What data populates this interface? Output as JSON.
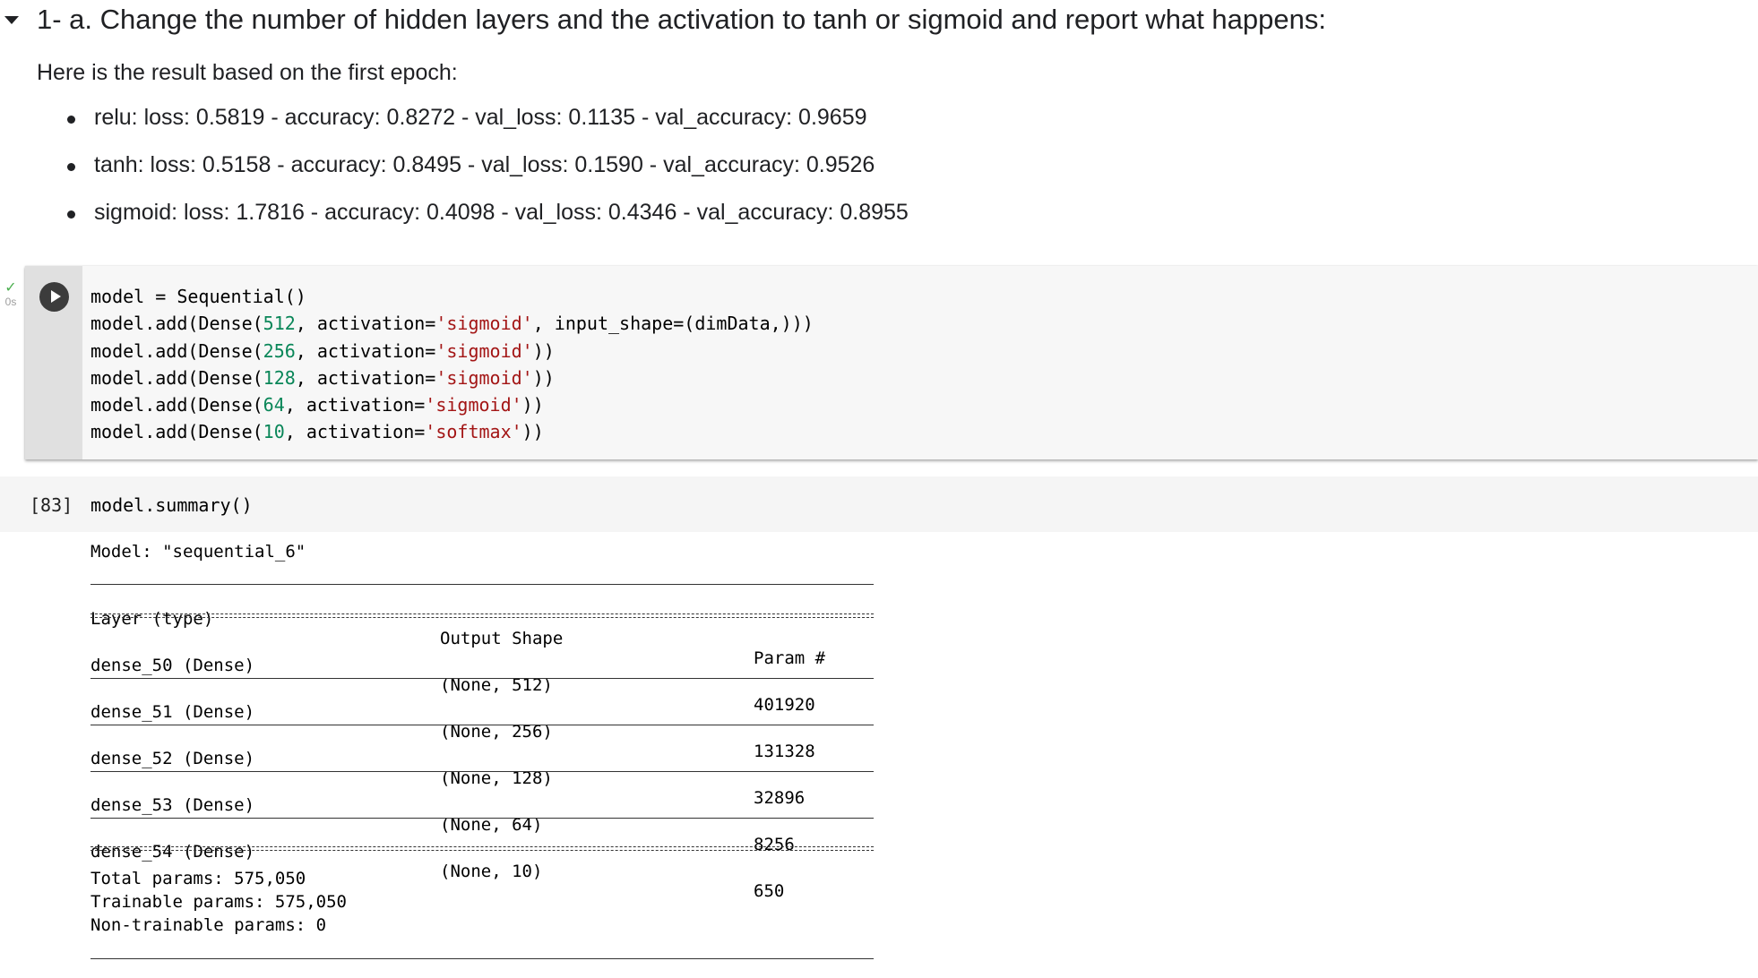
{
  "markdown": {
    "heading": "1- a. Change the number of hidden layers and the activation to tanh or sigmoid and report what happens:",
    "intro": "Here is the result based on the first epoch:",
    "results": [
      "relu: loss: 0.5819 - accuracy: 0.8272 - val_loss: 0.1135 - val_accuracy: 0.9659",
      "tanh: loss: 0.5158 - accuracy: 0.8495 - val_loss: 0.1590 - val_accuracy: 0.9526",
      "sigmoid: loss: 1.7816 - accuracy: 0.4098 - val_loss: 0.4346 - val_accuracy: 0.8955"
    ]
  },
  "cell1": {
    "status_time": "0s",
    "lines": [
      [
        {
          "t": "model = Sequential()",
          "k": ""
        }
      ],
      [
        {
          "t": "model.add(Dense(",
          "k": ""
        },
        {
          "t": "512",
          "k": "num"
        },
        {
          "t": ", activation=",
          "k": ""
        },
        {
          "t": "'sigmoid'",
          "k": "str"
        },
        {
          "t": ", input_shape=(dimData,)))",
          "k": ""
        }
      ],
      [
        {
          "t": "model.add(Dense(",
          "k": ""
        },
        {
          "t": "256",
          "k": "num"
        },
        {
          "t": ", activation=",
          "k": ""
        },
        {
          "t": "'sigmoid'",
          "k": "str"
        },
        {
          "t": "))",
          "k": ""
        }
      ],
      [
        {
          "t": "model.add(Dense(",
          "k": ""
        },
        {
          "t": "128",
          "k": "num"
        },
        {
          "t": ", activation=",
          "k": ""
        },
        {
          "t": "'sigmoid'",
          "k": "str"
        },
        {
          "t": "))",
          "k": ""
        }
      ],
      [
        {
          "t": "model.add(Dense(",
          "k": ""
        },
        {
          "t": "64",
          "k": "num"
        },
        {
          "t": ", activation=",
          "k": ""
        },
        {
          "t": "'sigmoid'",
          "k": "str"
        },
        {
          "t": "))",
          "k": ""
        }
      ],
      [
        {
          "t": "model.add(Dense(",
          "k": ""
        },
        {
          "t": "10",
          "k": "num"
        },
        {
          "t": ", activation=",
          "k": ""
        },
        {
          "t": "'softmax'",
          "k": "str"
        },
        {
          "t": "))",
          "k": ""
        }
      ]
    ]
  },
  "cell2": {
    "status_time": "0s",
    "exec_count": "[83]",
    "code": "model.summary()"
  },
  "summary": {
    "model_line": "Model: \"sequential_6\"",
    "headers": [
      "Layer (type)",
      "Output Shape",
      "Param #"
    ],
    "rows": [
      [
        "dense_50 (Dense)",
        "(None, 512)",
        "401920"
      ],
      [
        "dense_51 (Dense)",
        "(None, 256)",
        "131328"
      ],
      [
        "dense_52 (Dense)",
        "(None, 128)",
        "32896"
      ],
      [
        "dense_53 (Dense)",
        "(None, 64)",
        "8256"
      ],
      [
        "dense_54 (Dense)",
        "(None, 10)",
        "650"
      ]
    ],
    "total_params": "Total params: 575,050",
    "trainable_params": "Trainable params: 575,050",
    "non_trainable_params": "Non-trainable params: 0"
  }
}
